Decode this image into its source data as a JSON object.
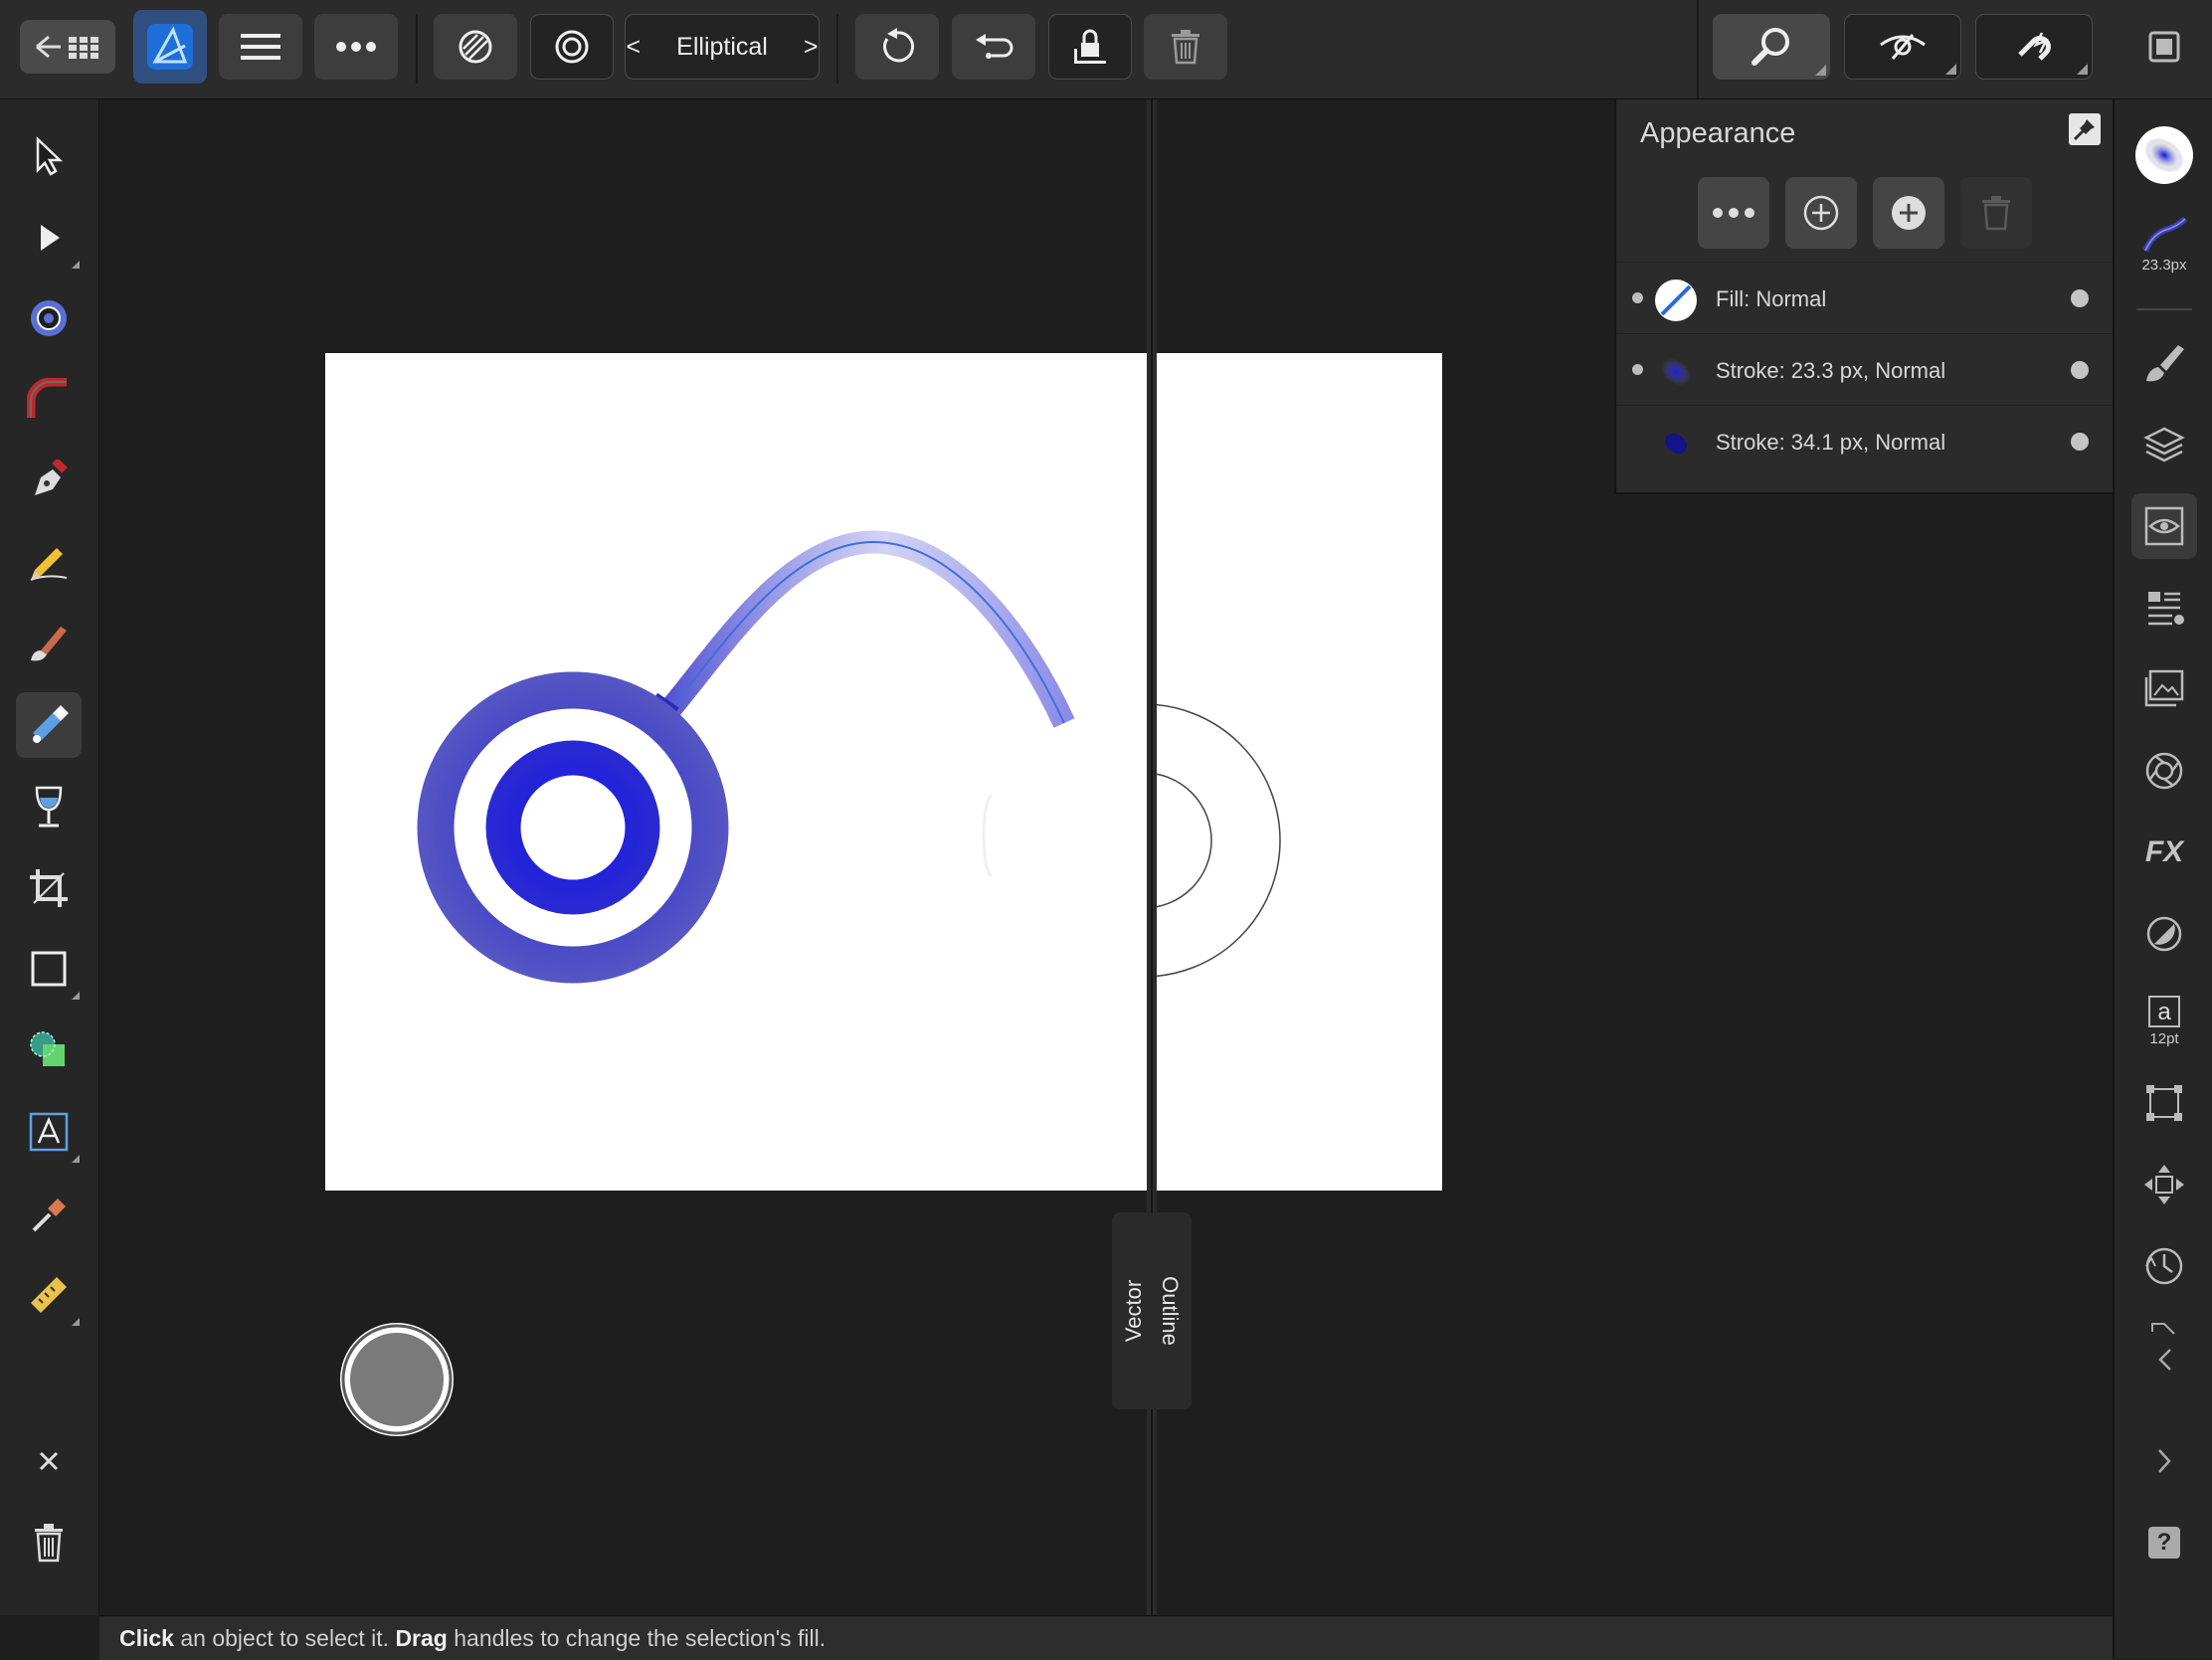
{
  "app": {
    "name": "Affinity Designer"
  },
  "toolbar": {
    "blend_mode_label": "Elliptical",
    "prev_icon": "chevron-left",
    "next_icon": "chevron-right"
  },
  "appearance_panel": {
    "title": "Appearance",
    "rows": [
      {
        "label": "Fill: Normal",
        "thumb": "fill-none-slash"
      },
      {
        "label": "Stroke: 23.3 px, Normal",
        "thumb": "blue-radial-dot"
      },
      {
        "label": "Stroke: 34.1 px, Normal",
        "thumb": "dark-blue-dot"
      }
    ]
  },
  "right_bar": {
    "stroke_width_label": "23.3px",
    "font_size_label": "12pt",
    "font_glyph": "a",
    "fx_label": "FX",
    "help_label": "?"
  },
  "split_view": {
    "left_label": "Vector",
    "right_label": "Outline"
  },
  "status_bar": {
    "part1": "Click",
    "part2": " an object to select it. ",
    "part3": "Drag",
    "part4": " handles to change the selection's fill."
  },
  "colors": {
    "accent_blue": "#2a2ad8",
    "ring_blue": "#4a4acd",
    "ui_dark": "#1e1e1e",
    "panel": "#2b2b2b"
  }
}
